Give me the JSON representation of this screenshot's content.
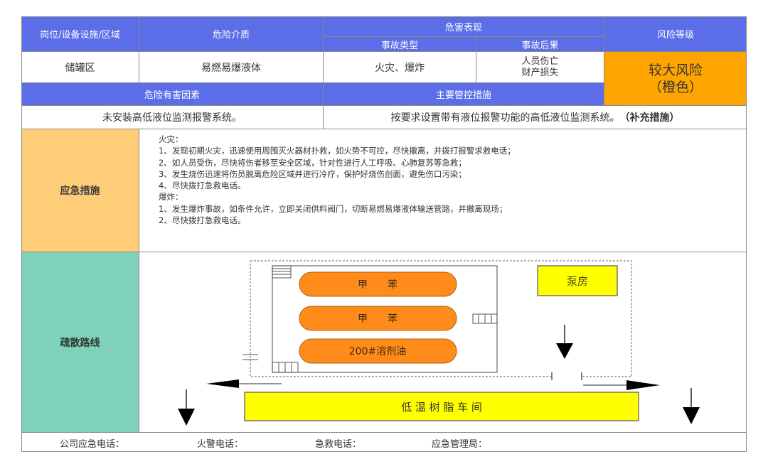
{
  "header": {
    "col_area": "岗位/设备设施/区域",
    "col_medium": "危险介质",
    "col_hazard_group": "危害表现",
    "col_accident_type": "事故类型",
    "col_consequence": "事故后果",
    "col_risk_level": "风险等级"
  },
  "row": {
    "area": "储罐区",
    "medium": "易燃易爆液体",
    "accident_type": "火灾、爆炸",
    "consequence_line1": "人员伤亡",
    "consequence_line2": "财产损失",
    "risk_level_line1": "较大风险",
    "risk_level_line2": "（橙色）"
  },
  "factors": {
    "header_factors": "危险有害因素",
    "header_controls": "主要管控措施",
    "factor_text": "未安装高低液位监测报警系统。",
    "control_text": "按要求设置带有液位报警功能的高低液位监测系统。",
    "control_note": "（补充措施）"
  },
  "emergency": {
    "label": "应急措施",
    "lines": [
      "火灾：",
      "1、发现初期火灾，迅速使用周围灭火器材扑救，如火势不可控，尽快撤离，并拨打报警求救电话；",
      "2、如人员受伤，尽快将伤者移至安全区域，针对性进行人工呼吸、心肺复苏等急救；",
      "3、发生烧伤迅速将伤员脱离危险区域并进行冷疗，保护好烧伤创面，避免伤口污染；",
      "4、尽快拨打急救电话。",
      "爆炸：",
      "1、发生爆炸事故，如条件允许，立即关闭供料阀门，切断易燃易爆液体输送管路，并撤离现场；",
      "2、尽快拨打急救电话。"
    ]
  },
  "evacuation": {
    "label": "疏散路线",
    "tanks": [
      "甲　　苯",
      "甲　　苯",
      "200#溶剂油"
    ],
    "pump_house": "泵房",
    "workshop": "低 温 树 脂 车 间"
  },
  "footer": {
    "company_phone": "公司应急电话：",
    "fire_phone": "火警电话：",
    "ambulance_phone": "急救电话：",
    "emergency_bureau": "应急管理局："
  },
  "colors": {
    "header_blue": "#5B6EE8",
    "risk_orange": "#FFA500",
    "emergency_peach": "#FFCC77",
    "evac_teal": "#7FD1B9",
    "tank_orange": "#FF8C1A",
    "building_yellow": "#FFFF00"
  }
}
